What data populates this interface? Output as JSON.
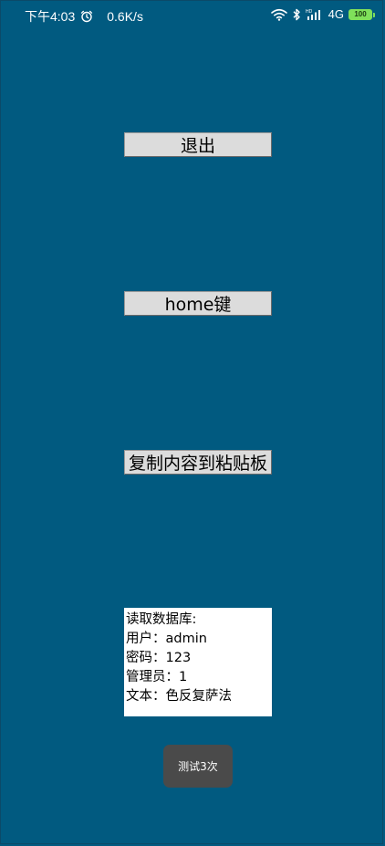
{
  "status_bar": {
    "time": "下午4:03",
    "alarm_icon": "alarm-clock-icon",
    "net_speed": "0.6K/s",
    "wifi_icon": "wifi-icon",
    "bluetooth_icon": "bluetooth-icon",
    "signal_icon": "cellular-signal-icon",
    "network_type": "4G",
    "battery_level": "100",
    "battery_color": "#7fe05a"
  },
  "buttons": {
    "exit_label": "退出",
    "home_label": "home键",
    "copy_label": "复制内容到粘贴板"
  },
  "info": {
    "lines": [
      "读取数据库:",
      "用户：admin",
      "密码：123",
      "管理员：1",
      "文本：色反复萨法"
    ]
  },
  "toast": {
    "text": "测试3次"
  },
  "colors": {
    "background": "#015a80",
    "button": "#dcdcdc",
    "toast": "#4a4a4a"
  }
}
